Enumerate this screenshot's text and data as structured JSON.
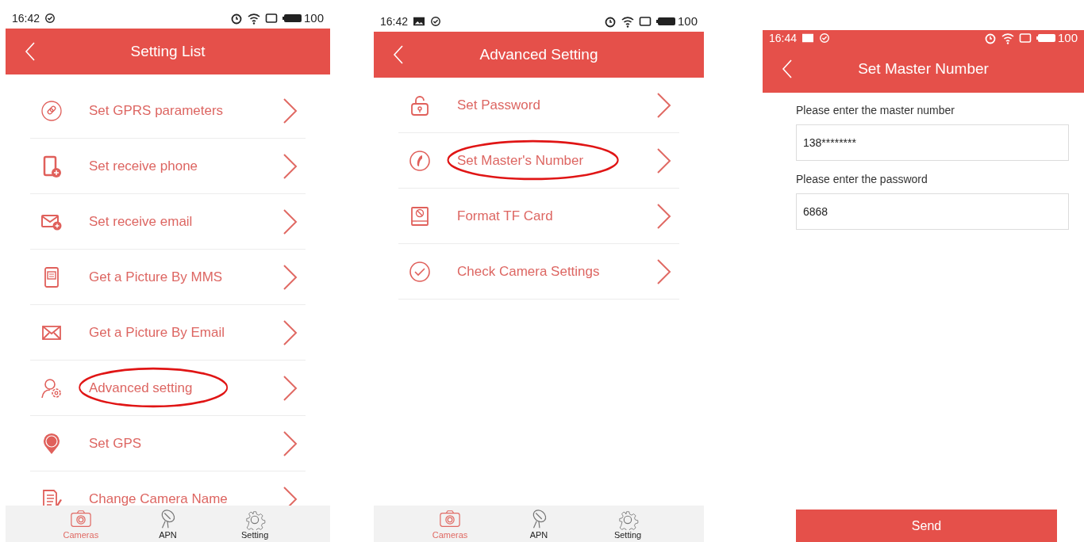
{
  "screens": [
    {
      "kind": "list",
      "status_bar": {
        "time": "16:42",
        "tinted": false,
        "notifications": [
          {
            "kind": "check"
          }
        ],
        "battery": "100"
      },
      "title": "Setting List",
      "items": [
        {
          "kind": "link",
          "label": "Set GPRS parameters",
          "circled": false
        },
        {
          "kind": "phone-add",
          "label": "Set receive phone",
          "circled": false
        },
        {
          "kind": "mail-add",
          "label": "Set receive email",
          "circled": false
        },
        {
          "kind": "phone-message",
          "label": "Get a Picture By MMS",
          "circled": false
        },
        {
          "kind": "mail",
          "label": "Get a Picture By Email",
          "circled": false
        },
        {
          "kind": "person-gear",
          "label": "Advanced setting",
          "circled": true
        },
        {
          "kind": "gps",
          "label": "Set GPS",
          "circled": false
        },
        {
          "kind": "edit",
          "label": "Change Camera Name",
          "circled": false
        }
      ],
      "tab_bar": [
        {
          "kind": "camera",
          "label": "Cameras",
          "selected": true
        },
        {
          "kind": "dish",
          "label": "APN",
          "selected": false
        },
        {
          "kind": "gear",
          "label": "Setting",
          "selected": false
        }
      ]
    },
    {
      "kind": "list",
      "status_bar": {
        "time": "16:42",
        "tinted": false,
        "notifications": [
          {
            "kind": "image"
          },
          {
            "kind": "check"
          }
        ],
        "battery": "100"
      },
      "title": "Advanced Setting",
      "items": [
        {
          "kind": "lock",
          "label": "Set Password",
          "circled": false
        },
        {
          "kind": "phone",
          "label": "Set Master's Number",
          "circled": true
        },
        {
          "kind": "card",
          "label": "Format TF Card",
          "circled": false
        },
        {
          "kind": "check",
          "label": "Check Camera Settings",
          "circled": false
        }
      ],
      "tab_bar": [
        {
          "kind": "camera",
          "label": "Cameras",
          "selected": true
        },
        {
          "kind": "dish",
          "label": "APN",
          "selected": false
        },
        {
          "kind": "gear",
          "label": "Setting",
          "selected": false
        }
      ]
    },
    {
      "kind": "form",
      "status_bar": {
        "time": "16:44",
        "tinted": true,
        "notifications": [
          {
            "kind": "image"
          },
          {
            "kind": "check"
          }
        ],
        "battery": "100"
      },
      "title": "Set Master Number",
      "fields": [
        {
          "label": "Please enter the master number",
          "value": "138********"
        },
        {
          "label": "Please enter the password",
          "value": "6868"
        }
      ],
      "button": "Send"
    }
  ]
}
